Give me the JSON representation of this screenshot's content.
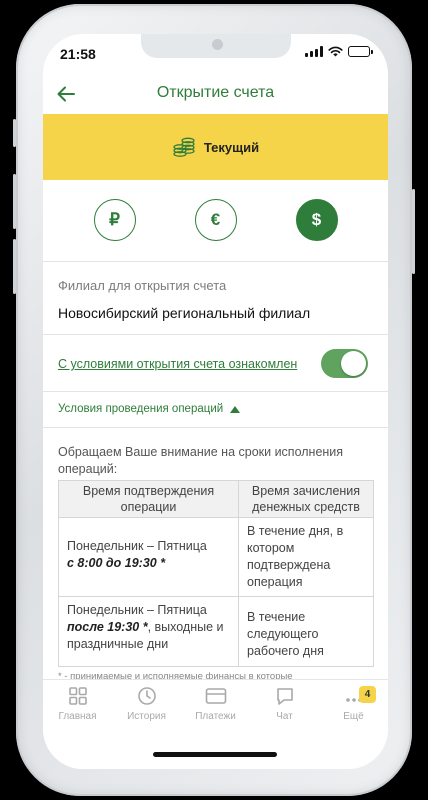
{
  "status_bar": {
    "time": "21:58"
  },
  "header": {
    "title": "Открытие счета"
  },
  "account_type": {
    "label": "Текущий"
  },
  "currencies": [
    {
      "symbol": "₽",
      "name": "rub",
      "selected": false
    },
    {
      "symbol": "€",
      "name": "eur",
      "selected": false
    },
    {
      "symbol": "$",
      "name": "usd",
      "selected": true
    }
  ],
  "branch": {
    "label": "Филиал для открытия счета",
    "value": "Новосибирский региональный филиал"
  },
  "terms": {
    "link_text": "С условиями открытия счета ознакомлен",
    "accepted": true
  },
  "operations": {
    "toggle_label": "Условия проведения операций",
    "note": "Обращаем Ваше внимание на сроки исполнения операций:",
    "table": {
      "headers": [
        "Время подтверждения операции",
        "Время зачисления денежных средств"
      ],
      "rows": [
        {
          "days": "Понедельник – Пятница",
          "time": "с 8:00 до 19:30 *",
          "extra": "",
          "credit": "В течение дня, в котором подтверждена операция"
        },
        {
          "days": "Понедельник – Пятница",
          "time": "после 19:30 *",
          "extra": ", выходные и праздничные дни",
          "credit": "В течение следующего рабочего дня"
        }
      ]
    },
    "footnote": "* - принимаемые и исполняемые финансы в которые"
  },
  "tabbar": {
    "items": [
      {
        "label": "Главная",
        "icon": "grid-icon"
      },
      {
        "label": "История",
        "icon": "clock-icon"
      },
      {
        "label": "Платежи",
        "icon": "wallet-icon"
      },
      {
        "label": "Чат",
        "icon": "chat-icon"
      },
      {
        "label": "Ещё",
        "icon": "more-icon",
        "badge": "4"
      }
    ]
  },
  "colors": {
    "accent": "#2f7d3a",
    "banner": "#f5d449",
    "toggle_on": "#5fa35f"
  }
}
